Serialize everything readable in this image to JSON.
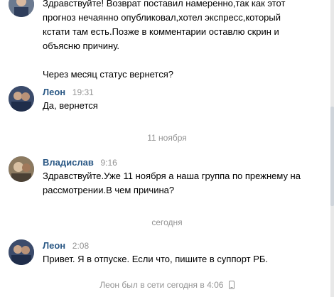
{
  "messages": [
    {
      "paragraphs": [
        "Здравствуйте! Возврат поставил намеренно,так как этот",
        "прогноз нечаянно опубликовал,хотел экспресс,который",
        "кстати там есть.Позже в комментарии оставлю скрин и",
        "объясню причину."
      ],
      "extra": "Через месяц статус вернется?"
    },
    {
      "author": "Леон",
      "time": "19:31",
      "lines": [
        "Да, вернется"
      ]
    },
    {
      "author": "Владислав",
      "time": "9:16",
      "lines": [
        "Здравствуйте.Уже 11 ноября а наша группа по прежнему на",
        "рассмотрении.В чем причина?"
      ]
    },
    {
      "author": "Леон",
      "time": "2:08",
      "lines": [
        "Привет. Я в отпуске. Если что, пишите в суппорт РБ."
      ]
    }
  ],
  "date_separators": [
    "11 ноября",
    "сегодня"
  ],
  "status_text": "Леон был в сети сегодня в 4:06",
  "icons": {
    "status": "phone-icon"
  },
  "colors": {
    "author": "#2a5885",
    "muted": "#939393",
    "background": "#ffffff"
  }
}
